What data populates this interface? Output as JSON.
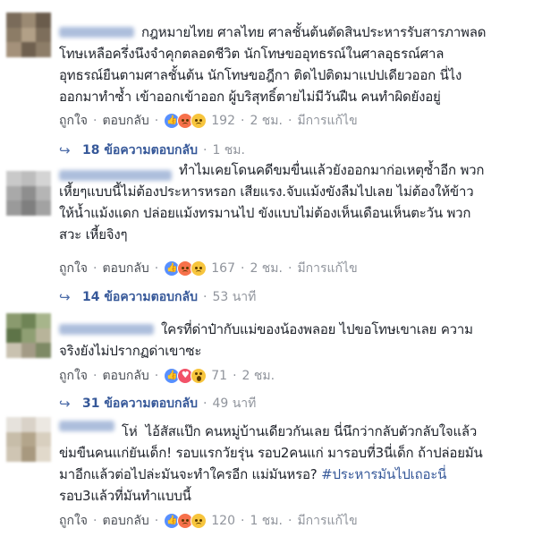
{
  "comments": [
    {
      "lines": [
        "กฎหมายไทย ศาลไทย ศาลชั้นต้นตัดสินประหารรับสารภาพลด",
        "โทษเหลือครึ่งนึงจำคุกตลอดชีวิต นักโทษขออุทธรณ์ในศาลอุธรณ์ศาล",
        "อุทธรณ์ยืนตามศาลชั้นต้น นักโทษขอฎีกา ติดไปติดมาแปปเดียวออก นี่ไง",
        "ออกมาทำซ้ำ เข้าออกเข้าออก ผู้บริสุทธิ์ตายไม่มีวันฝืน คนทำผิดยังอยู่"
      ],
      "like": "ถูกใจ",
      "reply": "ตอบกลับ",
      "reactions": [
        "like-icon",
        "angry-icon",
        "sad-icon"
      ],
      "reaction_count": "192",
      "time": "2 ชม.",
      "edited": "มีการแก้ไข",
      "replies_label": "18 ข้อความตอบกลับ",
      "replies_time": "1 ชม."
    },
    {
      "lines": [
        "ทำไมเคยโดนคดีขมขื่นแล้วยังออกมาก่อเหตุซ้ำอีก พวก",
        "เหี้ยๆแบบนี้ไม่ต้องประหารหรอก เสียแรง.จับแม้งขังลืมไปเลย ไม่ต้องให้ข้าว",
        "ให้น้ำแม้งแดก ปล่อยแม้งทรมานไป ขังแบบไม่ต้องเห็นเดือนเห็นตะวัน พวก",
        "สวะ เหี้ยจิงๆ"
      ],
      "like": "ถูกใจ",
      "reply": "ตอบกลับ",
      "reactions": [
        "like-icon",
        "angry-icon",
        "sad-icon"
      ],
      "reaction_count": "167",
      "time": "2 ชม.",
      "edited": "มีการแก้ไข",
      "replies_label": "14 ข้อความตอบกลับ",
      "replies_time": "53 นาที"
    },
    {
      "lines": [
        "ใครที่ด่าป๋ากับแม่ของน้องพลอย ไปขอโทษเขาเลย ความ",
        "จริงยังไม่ปรากฏด่าเขาซะ"
      ],
      "like": "ถูกใจ",
      "reply": "ตอบกลับ",
      "reactions": [
        "like-icon",
        "love-icon",
        "wow-icon"
      ],
      "reaction_count": "71",
      "time": "2 ชม.",
      "replies_label": "31 ข้อความตอบกลับ",
      "replies_time": "49 นาที"
    },
    {
      "lines": [
        "โห่  ไอ้สัสแป๊ก คนหมู่บ้านเดียวกันเลย นี่นึกว่ากลับตัวกลับใจแล้ว",
        "ข่มขืนคนแก่ยันเด็ก! รอบแรกวัยรุ่น รอบ2คนแก่ มารอบที่3นี่เด็ก ถ้าปล่อยมัน",
        "มาอีกแล้วต่อไปล่ะมันจะทำใครอีก แม่มันหรอ? ",
        "รอบ3แล้วที่มันทำแบบนี้"
      ],
      "hashtag": "#ประหารมันไปเถอะนี่",
      "like": "ถูกใจ",
      "reply": "ตอบกลับ",
      "reactions": [
        "like-icon",
        "angry-icon",
        "sad-icon"
      ],
      "reaction_count": "120",
      "time": "1 ชม.",
      "edited": "มีการแก้ไข"
    }
  ],
  "colors": {
    "link": "#365899",
    "meta": "#90949c",
    "text": "#1d2129"
  }
}
